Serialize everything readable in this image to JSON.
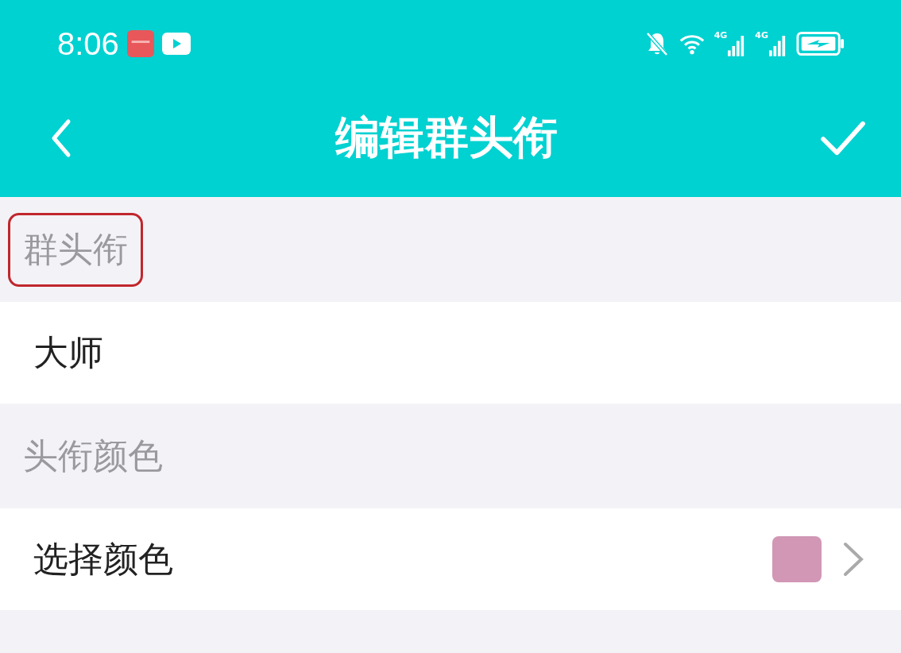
{
  "status_bar": {
    "time": "8:06",
    "network_labels": [
      "4G",
      "4G"
    ]
  },
  "header": {
    "title": "编辑群头衔"
  },
  "sections": [
    {
      "label": "群头衔",
      "highlighted": true,
      "row": {
        "kind": "value",
        "text": "大师"
      }
    },
    {
      "label": "头衔颜色",
      "highlighted": false,
      "row": {
        "kind": "color",
        "text": "选择颜色",
        "color": "#d197b5"
      }
    }
  ]
}
